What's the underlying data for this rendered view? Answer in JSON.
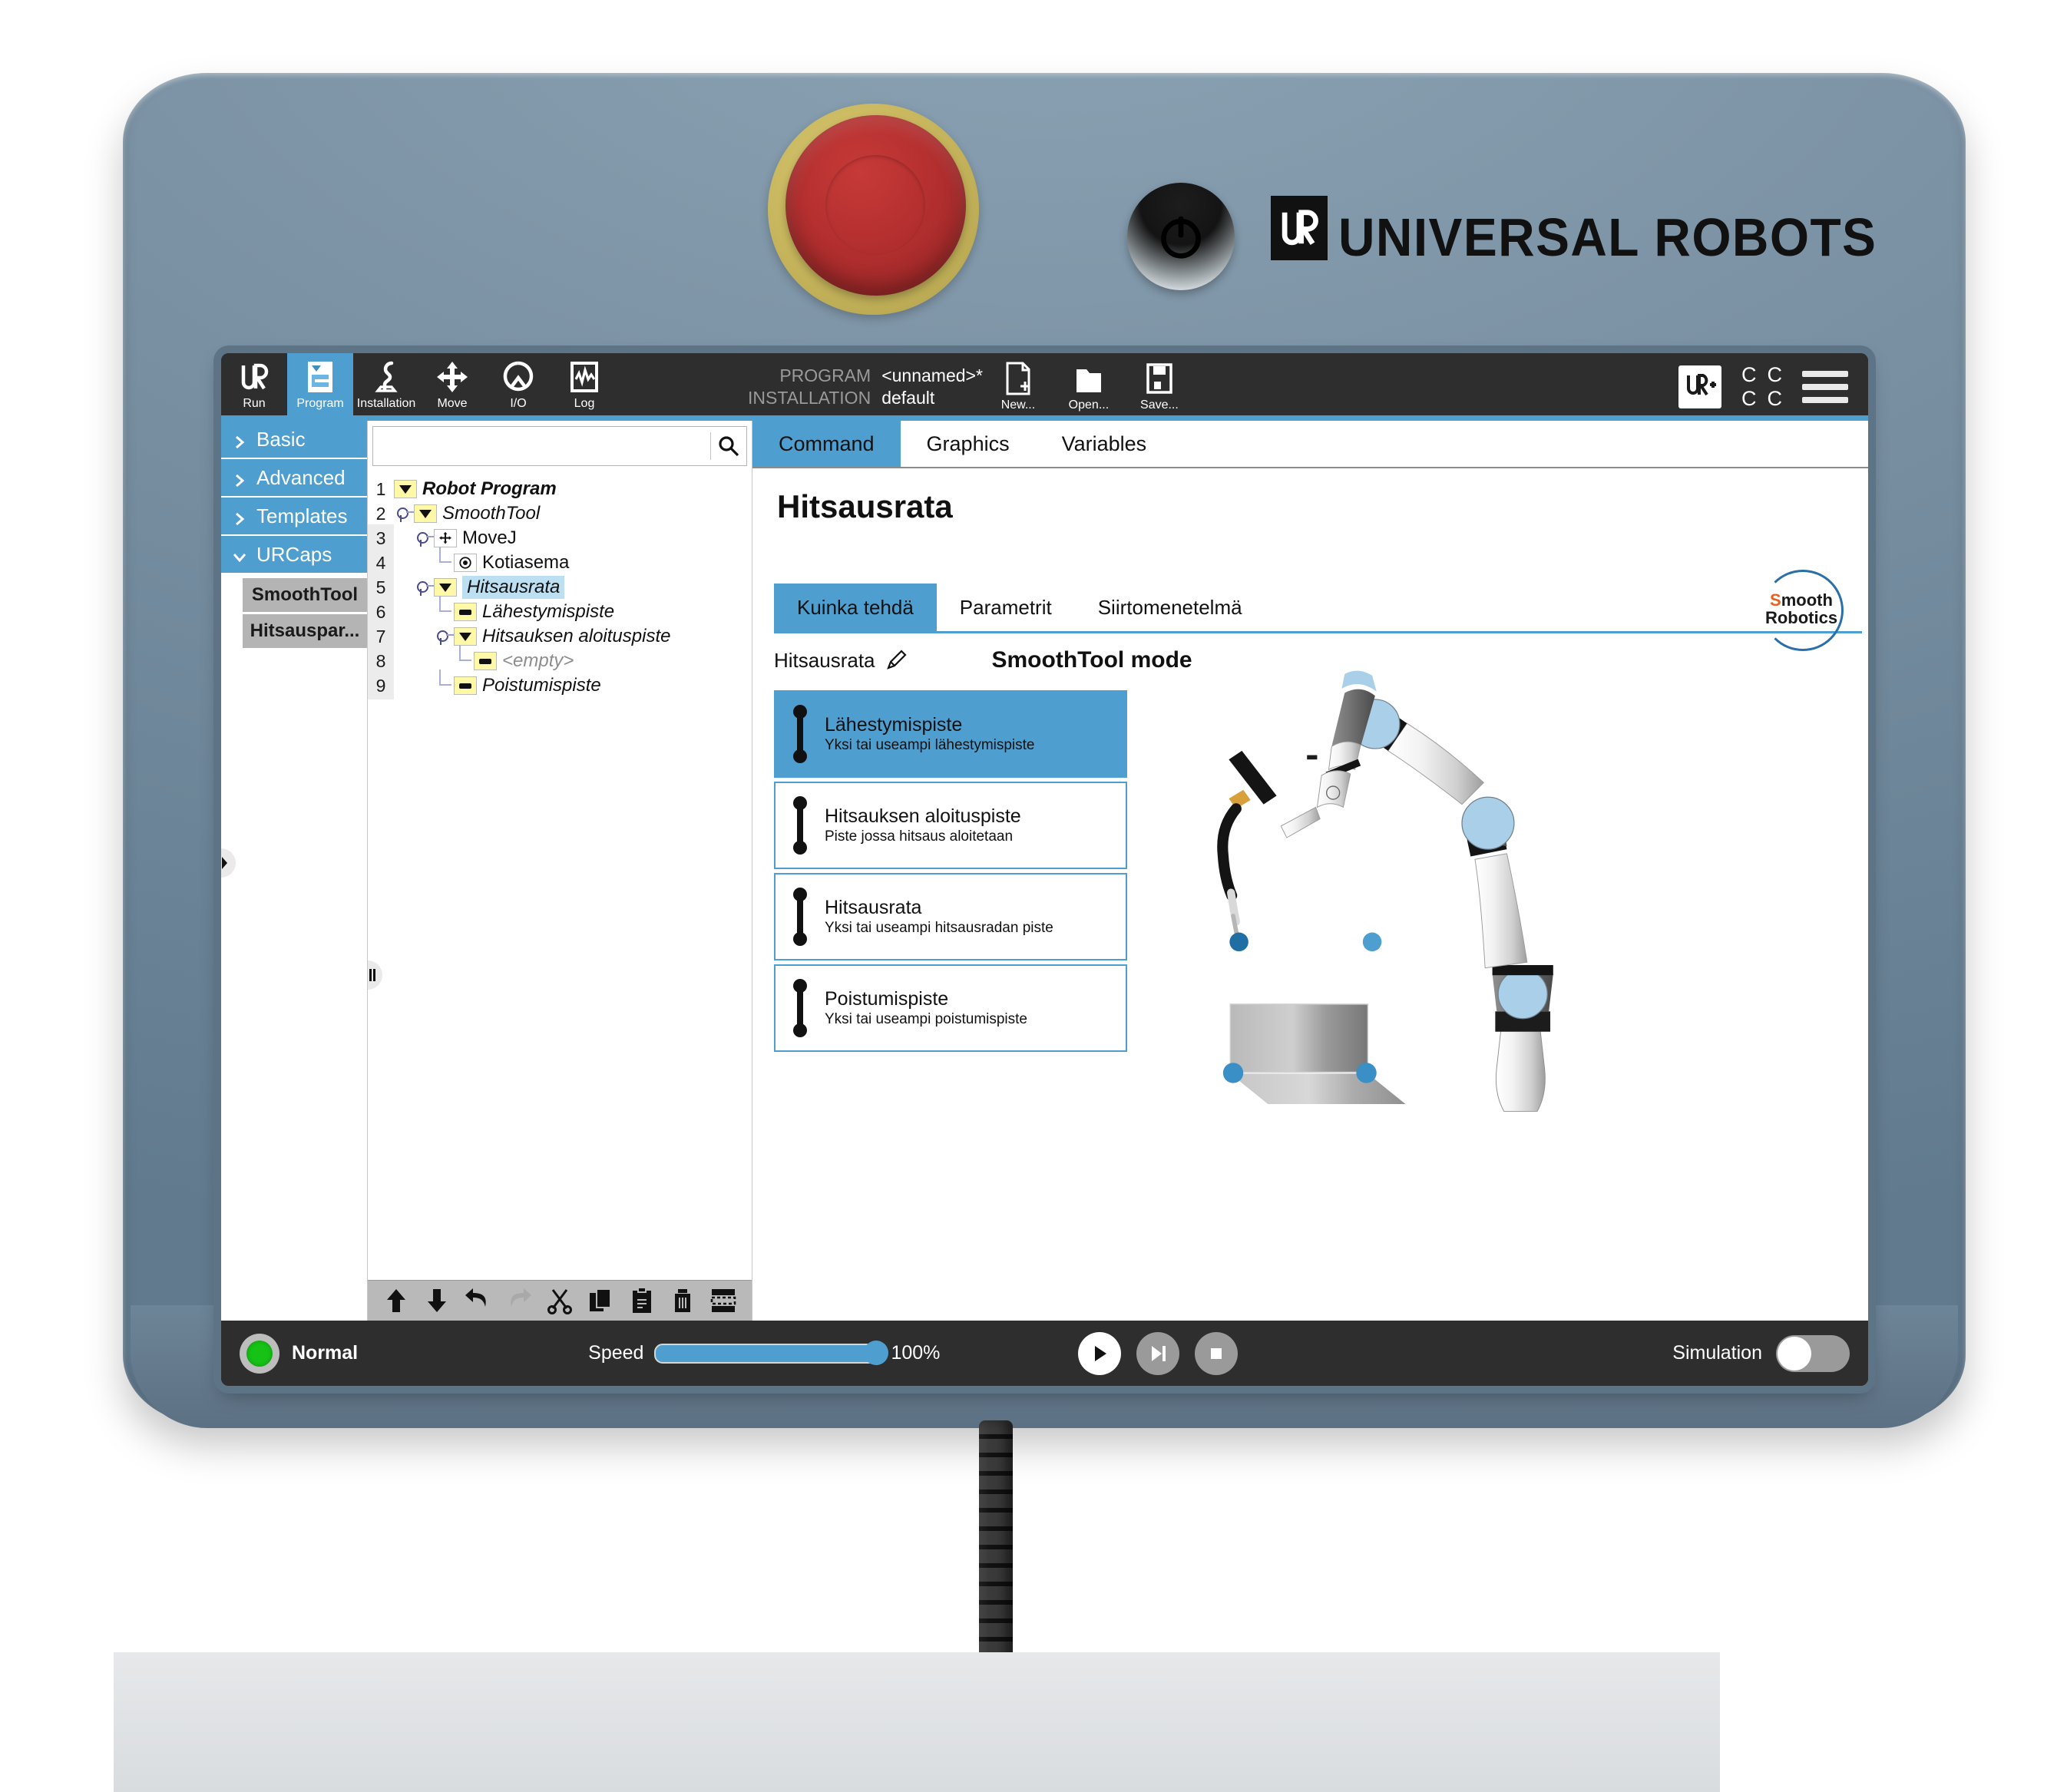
{
  "device": {
    "brand_name": "UNIVERSAL ROBOTS",
    "estop_name": "emergency-stop-button",
    "power_name": "power-button"
  },
  "header": {
    "tabs": [
      {
        "label": "Run",
        "icon": "ur-logo-icon",
        "active": false
      },
      {
        "label": "Program",
        "icon": "program-tree-icon",
        "active": true
      },
      {
        "label": "Installation",
        "icon": "robot-arm-icon",
        "active": false
      },
      {
        "label": "Move",
        "icon": "move-arrows-icon",
        "active": false
      },
      {
        "label": "I/O",
        "icon": "io-loop-icon",
        "active": false
      },
      {
        "label": "Log",
        "icon": "waveform-icon",
        "active": false
      }
    ],
    "program_key": "PROGRAM",
    "program_value": "<unnamed>*",
    "installation_key": "INSTALLATION",
    "installation_value": "default",
    "file_buttons": [
      {
        "label": "New...",
        "icon": "new-file-icon"
      },
      {
        "label": "Open...",
        "icon": "open-folder-icon"
      },
      {
        "label": "Save...",
        "icon": "save-disk-icon"
      }
    ],
    "urplus_label": "UR+",
    "safety_letters": [
      "C",
      "C",
      "C",
      "C"
    ],
    "menu_label": "hamburger-menu",
    "accent_color": "#4f9ed0"
  },
  "sidebar": {
    "items": [
      {
        "label": "Basic",
        "expanded": false
      },
      {
        "label": "Advanced",
        "expanded": false
      },
      {
        "label": "Templates",
        "expanded": false
      },
      {
        "label": "URCaps",
        "expanded": true
      }
    ],
    "urcaps_children": [
      {
        "label": "SmoothTool"
      },
      {
        "label": "Hitsauspar..."
      }
    ]
  },
  "search": {
    "value": "",
    "placeholder": "",
    "icon": "search-icon"
  },
  "program_tree": {
    "rows": [
      {
        "num": "1",
        "label": "Robot Program",
        "style": "bold-i",
        "icon": "triangle",
        "depth": 0,
        "connector": "none"
      },
      {
        "num": "2",
        "label": "SmoothTool",
        "style": "ital",
        "icon": "triangle",
        "depth": 1,
        "connector": "node"
      },
      {
        "num": "3",
        "label": "MoveJ",
        "style": "plain",
        "icon": "move",
        "depth": 2,
        "connector": "node"
      },
      {
        "num": "4",
        "label": "Kotiasema",
        "style": "plain",
        "icon": "waypoint",
        "depth": 3,
        "connector": "leaf"
      },
      {
        "num": "5",
        "label": "Hitsausrata",
        "style": "sel",
        "icon": "triangle",
        "depth": 2,
        "connector": "node"
      },
      {
        "num": "6",
        "label": "Lähestymispiste",
        "style": "ital",
        "icon": "dash",
        "depth": 3,
        "connector": "leaf"
      },
      {
        "num": "7",
        "label": "Hitsauksen aloituspiste",
        "style": "ital",
        "icon": "triangle",
        "depth": 3,
        "connector": "node"
      },
      {
        "num": "8",
        "label": "<empty>",
        "style": "empty",
        "icon": "dash",
        "depth": 4,
        "connector": "leaf"
      },
      {
        "num": "9",
        "label": "Poistumispiste",
        "style": "ital",
        "icon": "dash",
        "depth": 3,
        "connector": "leaf"
      }
    ]
  },
  "edit_toolbar": {
    "buttons": [
      {
        "name": "move-up-icon"
      },
      {
        "name": "move-down-icon"
      },
      {
        "name": "undo-icon"
      },
      {
        "name": "redo-icon"
      },
      {
        "name": "cut-icon"
      },
      {
        "name": "copy-icon"
      },
      {
        "name": "paste-icon"
      },
      {
        "name": "delete-icon"
      },
      {
        "name": "suppress-icon"
      }
    ]
  },
  "right_panel": {
    "tabs": [
      {
        "label": "Command",
        "active": true
      },
      {
        "label": "Graphics",
        "active": false
      },
      {
        "label": "Variables",
        "active": false
      }
    ],
    "title": "Hitsausrata",
    "inner_tabs": [
      {
        "label": "Kuinka tehdä",
        "active": true
      },
      {
        "label": "Parametrit",
        "active": false
      },
      {
        "label": "Siirtomenetelmä",
        "active": false
      }
    ],
    "vendor_logo": {
      "line1_accent": "S",
      "line1": "mooth",
      "line2": "Robotics"
    },
    "sub_name": "Hitsausrata",
    "edit_icon": "pencil-icon",
    "mode_title": "SmoothTool mode",
    "waypoint_cards": [
      {
        "title": "Lähestymispiste",
        "desc": "Yksi tai useampi lähestymispiste",
        "active": true
      },
      {
        "title": "Hitsauksen aloituspiste",
        "desc": "Piste jossa hitsaus aloitetaan",
        "active": false
      },
      {
        "title": "Hitsausrata",
        "desc": "Yksi tai useampi hitsausradan piste",
        "active": false
      },
      {
        "title": "Poistumispiste",
        "desc": "Yksi tai useampi poistumispiste",
        "active": false
      }
    ]
  },
  "footer": {
    "status_text": "Normal",
    "status_color": "#16c216",
    "speed_label": "Speed",
    "speed_percent": "100%",
    "transport": [
      {
        "name": "play-button"
      },
      {
        "name": "step-button"
      },
      {
        "name": "stop-button"
      }
    ],
    "simulation_label": "Simulation",
    "simulation_on": false
  }
}
